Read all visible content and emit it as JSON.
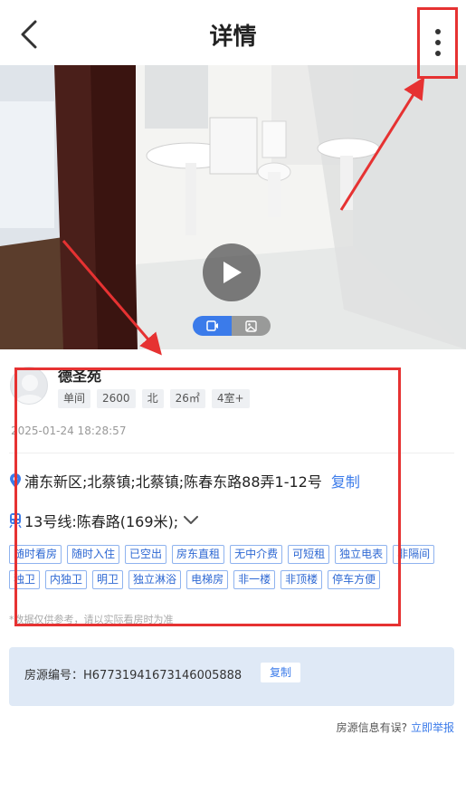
{
  "header": {
    "title": "详情"
  },
  "media": {
    "toggle_items": [
      "video-icon",
      "image-icon"
    ],
    "active_toggle": "video-icon"
  },
  "listing": {
    "community_name": "德圣苑",
    "tags": [
      "单间",
      "2600",
      "北",
      "26㎡",
      "4室+"
    ],
    "timestamp": "2025-01-24 18:28:57",
    "address": "浦东新区;北蔡镇;北蔡镇;陈春东路88弄1-12号",
    "address_copy": "复制",
    "metro": "13号线:陈春路(169米);",
    "features_row1": [
      "随时看房",
      "随时入住",
      "已空出",
      "房东直租",
      "无中介费",
      "可短租",
      "独立电表"
    ],
    "features_row2": [
      "非隔间",
      "独卫",
      "内独卫",
      "明卫",
      "独立淋浴",
      "电梯房",
      "非一楼",
      "非顶楼",
      "停车方便"
    ],
    "disclaimer": "*数据仅供参考，请以实际看房时为准"
  },
  "source_code": {
    "label": "房源编号：H67731941673146005888",
    "copy_label": "复制"
  },
  "report": {
    "question": "房源信息有误?",
    "link": "立即举报"
  },
  "colors": {
    "accent": "#3b7bea",
    "annotation": "#e63232",
    "card_bg": "#dfe9f6"
  }
}
